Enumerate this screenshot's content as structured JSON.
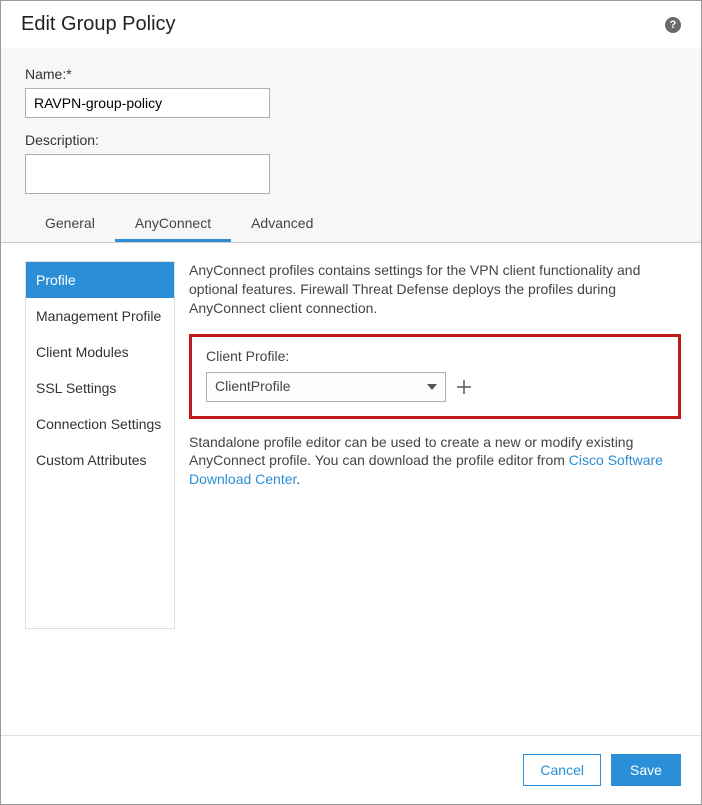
{
  "header": {
    "title": "Edit Group Policy"
  },
  "form": {
    "name_label": "Name:*",
    "name_value": "RAVPN-group-policy",
    "description_label": "Description:",
    "description_value": ""
  },
  "tabs": {
    "general": "General",
    "anyconnect": "AnyConnect",
    "advanced": "Advanced"
  },
  "sidebar": {
    "items": [
      {
        "label": "Profile"
      },
      {
        "label": "Management Profile"
      },
      {
        "label": "Client Modules"
      },
      {
        "label": "SSL Settings"
      },
      {
        "label": "Connection Settings"
      },
      {
        "label": "Custom Attributes"
      }
    ]
  },
  "content": {
    "description": "AnyConnect profiles contains settings for the VPN client functionality and optional features. Firewall Threat Defense deploys the profiles during AnyConnect client connection.",
    "client_profile_label": "Client Profile:",
    "client_profile_value": "ClientProfile",
    "footnote_before": "Standalone profile editor can be used to create a new or modify existing AnyConnect profile. You can download the profile editor from ",
    "footnote_link": "Cisco Software Download Center",
    "footnote_after": "."
  },
  "footer": {
    "cancel": "Cancel",
    "save": "Save"
  }
}
